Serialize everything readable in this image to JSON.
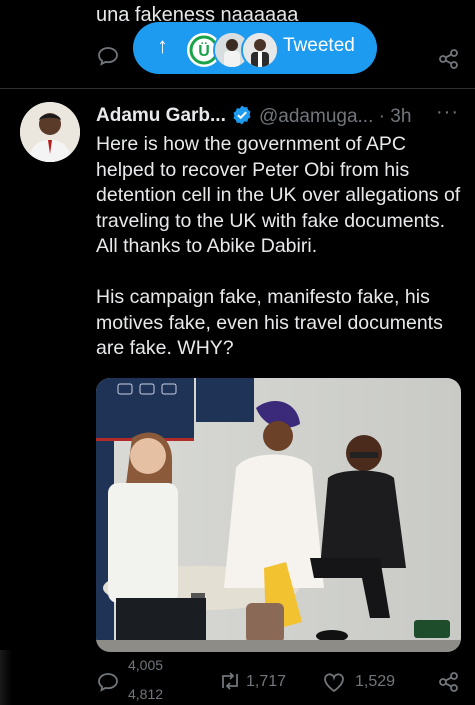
{
  "previous_tweet": {
    "text": "una fakeness naaaaaa"
  },
  "toast": {
    "label": "Tweeted"
  },
  "tweet": {
    "display_name": "Adamu Garb...",
    "handle": "@adamuga...",
    "time": "· 3h",
    "more": "···",
    "text": "Here is how the government of APC helped to recover Peter Obi from his detention cell in the UK over allegations of traveling to the UK with fake documents. All thanks to Abike Dabiri.\n\nHis campaign fake, manifesto fake, his motives fake, even his travel documents are fake. WHY?",
    "replies_top": "4,005",
    "replies_bottom": "4,812",
    "retweets": "1,717",
    "likes": "1,529"
  },
  "colors": {
    "accent": "#1d9bf0",
    "muted": "#71767b",
    "text": "#e7e9ea",
    "background": "#000000"
  }
}
